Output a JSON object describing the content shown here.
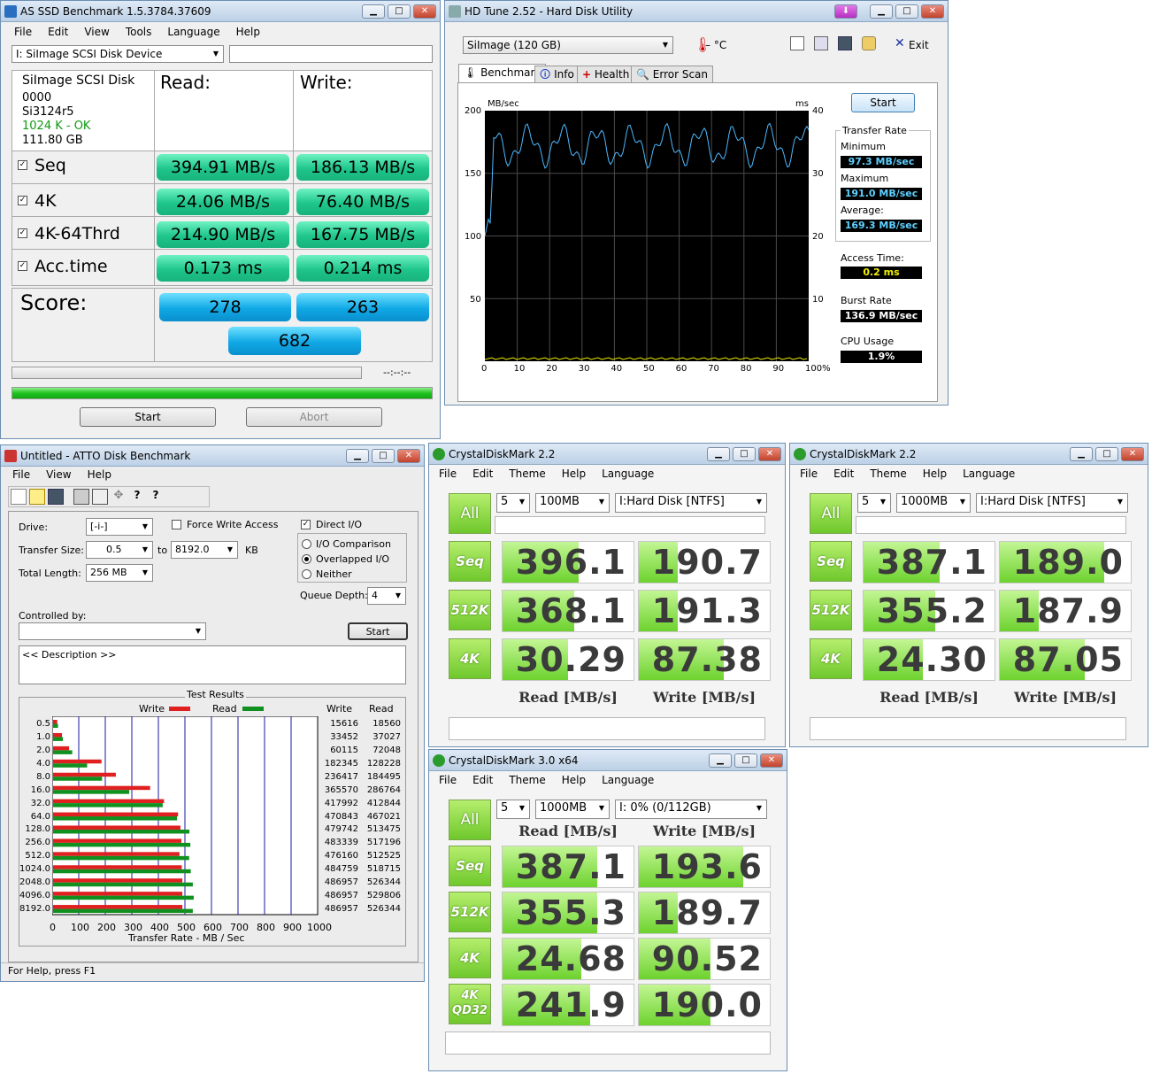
{
  "asssd": {
    "title": "AS SSD Benchmark 1.5.3784.37609",
    "menu": [
      "File",
      "Edit",
      "View",
      "Tools",
      "Language",
      "Help"
    ],
    "drive": "I: SiImage  SCSI Disk Device",
    "info": [
      "SiImage  SCSI Disk",
      "0000",
      "Si3124r5",
      "1024 K - OK",
      "111.80 GB"
    ],
    "read_label": "Read:",
    "write_label": "Write:",
    "rows": [
      {
        "label": "Seq",
        "read": "394.91 MB/s",
        "write": "186.13 MB/s"
      },
      {
        "label": "4K",
        "read": "24.06 MB/s",
        "write": "76.40 MB/s"
      },
      {
        "label": "4K-64Thrd",
        "read": "214.90 MB/s",
        "write": "167.75 MB/s"
      },
      {
        "label": "Acc.time",
        "read": "0.173 ms",
        "write": "0.214 ms"
      }
    ],
    "score_label": "Score:",
    "score_read": "278",
    "score_write": "263",
    "score_total": "682",
    "time": "--:--:--",
    "start": "Start",
    "abort": "Abort"
  },
  "hdtune": {
    "title": "HD Tune 2.52 - Hard Disk Utility",
    "drive": "SiImage  (120 GB)",
    "temp": "– °C",
    "exit": "Exit",
    "tabs": [
      "Benchmark",
      "Info",
      "Health",
      "Error Scan"
    ],
    "y_left_unit": "MB/sec",
    "y_right_unit": "ms",
    "y_left": [
      "200",
      "150",
      "100",
      "50"
    ],
    "y_right": [
      "40",
      "30",
      "20",
      "10"
    ],
    "x_ticks": [
      "0",
      "10",
      "20",
      "30",
      "40",
      "50",
      "60",
      "70",
      "80",
      "90",
      "100%"
    ],
    "start": "Start",
    "transfer_rate": "Transfer Rate",
    "minimum_label": "Minimum",
    "minimum": "97.3 MB/sec",
    "maximum_label": "Maximum",
    "maximum": "191.0 MB/sec",
    "average_label": "Average:",
    "average": "169.3 MB/sec",
    "access_label": "Access Time:",
    "access": "0.2 ms",
    "burst_label": "Burst Rate",
    "burst": "136.9 MB/sec",
    "cpu_label": "CPU Usage",
    "cpu": "1.9%"
  },
  "atto": {
    "title": "Untitled - ATTO Disk Benchmark",
    "menu": [
      "File",
      "View",
      "Help"
    ],
    "drive_label": "Drive:",
    "drive": "[-i-]",
    "transfer_label": "Transfer Size:",
    "transfer_from": "0.5",
    "to_label": "to",
    "transfer_to": "8192.0",
    "kb": "KB",
    "length_label": "Total Length:",
    "length": "256 MB",
    "force_write": "Force Write Access",
    "direct_io": "Direct I/O",
    "io_comparison": "I/O Comparison",
    "overlapped": "Overlapped I/O",
    "neither": "Neither",
    "queue_label": "Queue Depth:",
    "queue": "4",
    "controlled_label": "Controlled by:",
    "start": "Start",
    "description": "<< Description >>",
    "results_title": "Test Results",
    "write_legend": "Write",
    "read_legend": "Read",
    "col_write": "Write",
    "col_read": "Read",
    "x_ticks": [
      "0",
      "100",
      "200",
      "300",
      "400",
      "500",
      "600",
      "700",
      "800",
      "900",
      "1000"
    ],
    "x_label": "Transfer Rate - MB / Sec",
    "status": "For Help, press F1",
    "colors": {
      "write": "#e02020",
      "read": "#10901e"
    }
  },
  "chart_data": {
    "type": "bar",
    "title": "Test Results",
    "xlabel": "Transfer Rate - MB / Sec",
    "xlim": [
      0,
      1000
    ],
    "categories": [
      "0.5",
      "1.0",
      "2.0",
      "4.0",
      "8.0",
      "16.0",
      "32.0",
      "64.0",
      "128.0",
      "256.0",
      "512.0",
      "1024.0",
      "2048.0",
      "4096.0",
      "8192.0"
    ],
    "series": [
      {
        "name": "Write",
        "values": [
          15616,
          33452,
          60115,
          182345,
          236417,
          365570,
          417992,
          470843,
          479742,
          483339,
          476160,
          484759,
          486957,
          486957,
          486957
        ]
      },
      {
        "name": "Read",
        "values": [
          18560,
          37027,
          72048,
          128228,
          184495,
          286764,
          412844,
          467021,
          513475,
          517196,
          512525,
          518715,
          526344,
          529806,
          526344
        ]
      }
    ]
  },
  "cdm1": {
    "title": "CrystalDiskMark 2.2",
    "menu": [
      "File",
      "Edit",
      "Theme",
      "Help",
      "Language"
    ],
    "count": "5",
    "size": "100MB",
    "drive": "I:Hard Disk [NTFS]",
    "all": "All",
    "rows": [
      {
        "label": "Seq",
        "read": "396.1",
        "write": "190.7",
        "rf": 0.58,
        "wf": 0.3
      },
      {
        "label": "512K",
        "read": "368.1",
        "write": "191.3",
        "rf": 0.55,
        "wf": 0.3
      },
      {
        "label": "4K",
        "read": "30.29",
        "write": "87.38",
        "rf": 0.5,
        "wf": 0.65
      }
    ],
    "read_hdr": "Read [MB/s]",
    "write_hdr": "Write [MB/s]"
  },
  "cdm2": {
    "title": "CrystalDiskMark 2.2",
    "menu": [
      "File",
      "Edit",
      "Theme",
      "Help",
      "Language"
    ],
    "count": "5",
    "size": "1000MB",
    "drive": "I:Hard Disk [NTFS]",
    "all": "All",
    "rows": [
      {
        "label": "Seq",
        "read": "387.1",
        "write": "189.0",
        "rf": 0.58,
        "wf": 0.8
      },
      {
        "label": "512K",
        "read": "355.2",
        "write": "187.9",
        "rf": 0.55,
        "wf": 0.3
      },
      {
        "label": "4K",
        "read": "24.30",
        "write": "87.05",
        "rf": 0.45,
        "wf": 0.65
      }
    ],
    "read_hdr": "Read [MB/s]",
    "write_hdr": "Write [MB/s]"
  },
  "cdm3": {
    "title": "CrystalDiskMark 3.0 x64",
    "menu": [
      "File",
      "Edit",
      "Theme",
      "Help",
      "Language"
    ],
    "count": "5",
    "size": "1000MB",
    "drive": "I: 0% (0/112GB)",
    "all": "All",
    "read_hdr": "Read [MB/s]",
    "write_hdr": "Write [MB/s]",
    "rows": [
      {
        "label": "Seq",
        "read": "387.1",
        "write": "193.6",
        "rf": 0.72,
        "wf": 0.8
      },
      {
        "label": "512K",
        "read": "355.3",
        "write": "189.7",
        "rf": 0.72,
        "wf": 0.3
      },
      {
        "label": "4K",
        "read": "24.68",
        "write": "90.52",
        "rf": 0.6,
        "wf": 0.55
      },
      {
        "label": "4K QD32",
        "read": "241.9",
        "write": "190.0",
        "rf": 0.67,
        "wf": 0.55
      }
    ]
  }
}
